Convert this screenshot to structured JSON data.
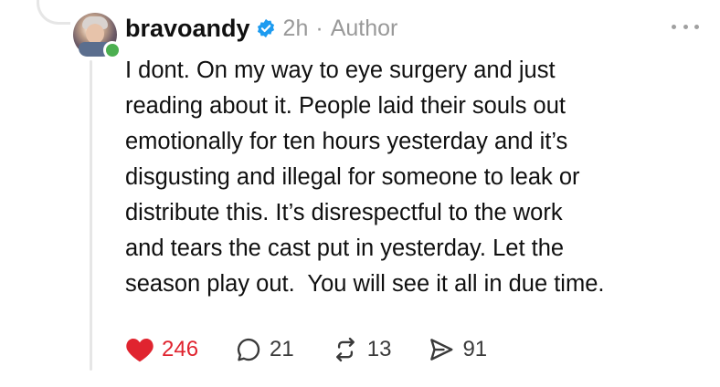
{
  "post": {
    "username": "bravoandy",
    "verified": true,
    "time": "2h",
    "separator": "·",
    "role": "Author",
    "lines": [
      "I dont. On my way to eye surgery and just",
      "reading about it. People laid their souls out",
      "emotionally for ten hours yesterday and it’s",
      "disgusting and illegal for someone to leak or",
      "distribute this. It’s disrespectful to the work",
      "and tears the cast put in yesterday. Let the",
      "season play out.  You will see it all in due time."
    ]
  },
  "actions": {
    "likes": "246",
    "replies": "21",
    "reposts": "13",
    "shares": "91"
  },
  "colors": {
    "like_red": "#e0242f",
    "verified_blue": "#1d9bf0",
    "online_green": "#4caf50"
  },
  "icons": [
    "heart-icon",
    "reply-icon",
    "repost-icon",
    "share-icon",
    "verified-icon",
    "more-icon"
  ]
}
